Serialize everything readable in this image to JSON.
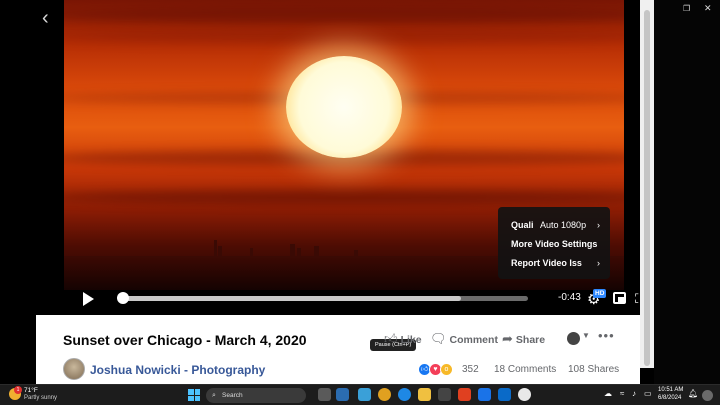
{
  "video": {
    "elapsed_fraction": 0.835,
    "time_remaining": "-0:43",
    "quality_badge": "HD",
    "settings_menu": {
      "quality_label": "Quali",
      "quality_value": "Auto 1080p",
      "more_settings_label": "More Video Settings",
      "report_label": "Report Video Iss"
    }
  },
  "post": {
    "title": "Sunset over Chicago - March 4, 2020",
    "tooltip": "Pause (Ctrl+P)",
    "like_label": "Like",
    "comment_label": "Comment",
    "share_label": "Share",
    "author": "Joshua Nowicki - Photography",
    "reaction_count": "352",
    "comments_count": "18 Comments",
    "shares_count": "108 Shares"
  },
  "taskbar": {
    "weather_badge": "1",
    "temperature": "71°F",
    "condition": "Partly sunny",
    "search_placeholder": "Search",
    "time": "10:51 AM",
    "date": "6/8/2024"
  },
  "colors": {
    "accent_blue": "#2d88ff",
    "author_link": "#385898",
    "like_reaction": "#1877f2",
    "love_reaction": "#f33e58",
    "wow_reaction": "#f7b928"
  },
  "icons": {
    "back": "chevron-left-icon",
    "play": "play-icon",
    "settings": "gear-icon",
    "pip": "picture-in-picture-icon",
    "fullscreen": "fullscreen-icon",
    "volume": "volume-icon",
    "like": "thumbs-up-icon",
    "comment": "comment-icon",
    "share": "share-icon"
  }
}
